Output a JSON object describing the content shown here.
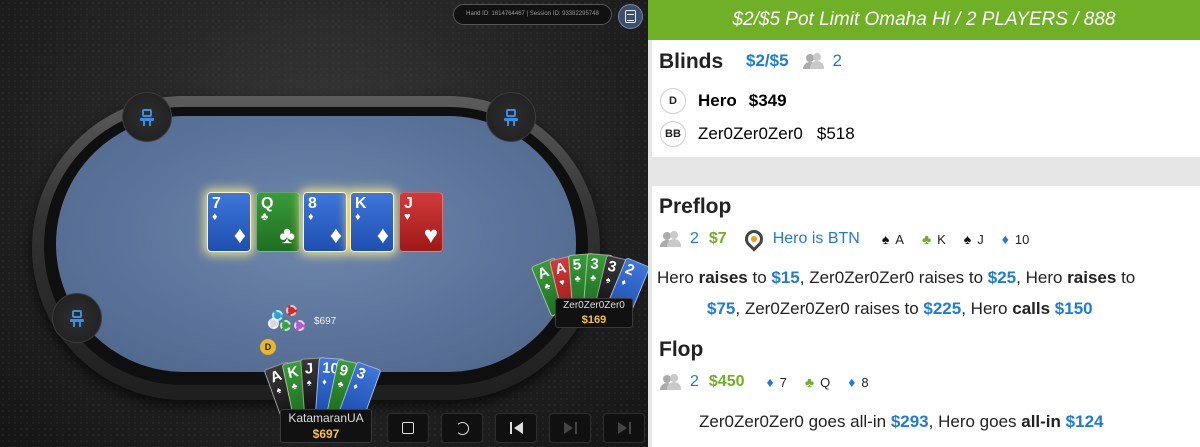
{
  "replayer": {
    "ids_text": "Hand ID: 1614764467  |  Session ID: 93382295748",
    "pot_amount": "$697",
    "dealer_label": "D",
    "board": [
      {
        "rank": "7",
        "suit": "♦",
        "color": "blue",
        "highlighted": true
      },
      {
        "rank": "Q",
        "suit": "♣",
        "color": "green",
        "highlighted": false
      },
      {
        "rank": "8",
        "suit": "♦",
        "color": "blue",
        "highlighted": true
      },
      {
        "rank": "K",
        "suit": "♦",
        "color": "blue",
        "highlighted": true
      },
      {
        "rank": "J",
        "suit": "♥",
        "color": "red",
        "highlighted": false
      }
    ],
    "villain": {
      "name": "Zer0Zer0Zer0",
      "stack": "$169",
      "cards": [
        {
          "rank": "A",
          "suit": "♣",
          "color": "green"
        },
        {
          "rank": "A",
          "suit": "♥",
          "color": "red"
        },
        {
          "rank": "5",
          "suit": "♣",
          "color": "green"
        },
        {
          "rank": "3",
          "suit": "♣",
          "color": "green"
        },
        {
          "rank": "3",
          "suit": "♠",
          "color": "black"
        },
        {
          "rank": "2",
          "suit": "♦",
          "color": "blue"
        }
      ]
    },
    "hero": {
      "name": "KatamaranUA",
      "stack": "$697",
      "cards": [
        {
          "rank": "A",
          "suit": "♠",
          "color": "black"
        },
        {
          "rank": "K",
          "suit": "♣",
          "color": "green"
        },
        {
          "rank": "J",
          "suit": "♠",
          "color": "black"
        },
        {
          "rank": "10",
          "suit": "♦",
          "color": "blue"
        },
        {
          "rank": "9",
          "suit": "♣",
          "color": "green"
        },
        {
          "rank": "3",
          "suit": "♦",
          "color": "blue"
        }
      ]
    },
    "controls": [
      "stop-icon",
      "replay-icon",
      "skip-back-icon",
      "step-forward-icon",
      "skip-forward-icon"
    ]
  },
  "history": {
    "header": "$2/$5 Pot Limit Omaha Hi / 2 PLAYERS / 888",
    "blinds": {
      "title": "Blinds",
      "stakes": "$2/$5",
      "players": "2",
      "seats": [
        {
          "badge": "D",
          "name": "Hero",
          "stack": "$349",
          "bold": true
        },
        {
          "badge": "BB",
          "name": "Zer0Zer0Zer0",
          "stack": "$518",
          "bold": false
        }
      ]
    },
    "preflop": {
      "title": "Preflop",
      "players": "2",
      "pot": "$7",
      "position": "Hero is BTN",
      "hero_cards": [
        {
          "suit": "♠",
          "rank": "A",
          "color": "#111111"
        },
        {
          "suit": "♣",
          "rank": "K",
          "color": "#6fb026"
        },
        {
          "suit": "♠",
          "rank": "J",
          "color": "#111111"
        },
        {
          "suit": "♦",
          "rank": "10",
          "color": "#1e7cd8"
        }
      ],
      "action": {
        "p1": "Hero ",
        "a1": "raises",
        "t1": " to ",
        "v1": "$15",
        "p2": ", Zer0Zer0Zer0 raises to ",
        "v2": "$25",
        "p3": ", Hero ",
        "a3": "raises",
        "t3": " to",
        "v3": "$75",
        "p4": ", Zer0Zer0Zer0 raises to ",
        "v4": "$225",
        "p5": ", Hero ",
        "a5": "calls",
        "v5": "$150"
      }
    },
    "flop": {
      "title": "Flop",
      "players": "2",
      "pot": "$450",
      "board": [
        {
          "suit": "♦",
          "rank": "7",
          "color": "#1e7cd8"
        },
        {
          "suit": "♣",
          "rank": "Q",
          "color": "#6fb026"
        },
        {
          "suit": "♦",
          "rank": "8",
          "color": "#1e7cd8"
        }
      ],
      "action": {
        "p1": "Zer0Zer0Zer0 goes all-in ",
        "v1": "$293",
        "p2": ", Hero goes ",
        "a2": "all-in",
        "v2": "$124"
      }
    }
  },
  "colors": {
    "accent_green": "#6fb026",
    "link_blue": "#1e7cd8",
    "stack_gold": "#f5c33b"
  }
}
